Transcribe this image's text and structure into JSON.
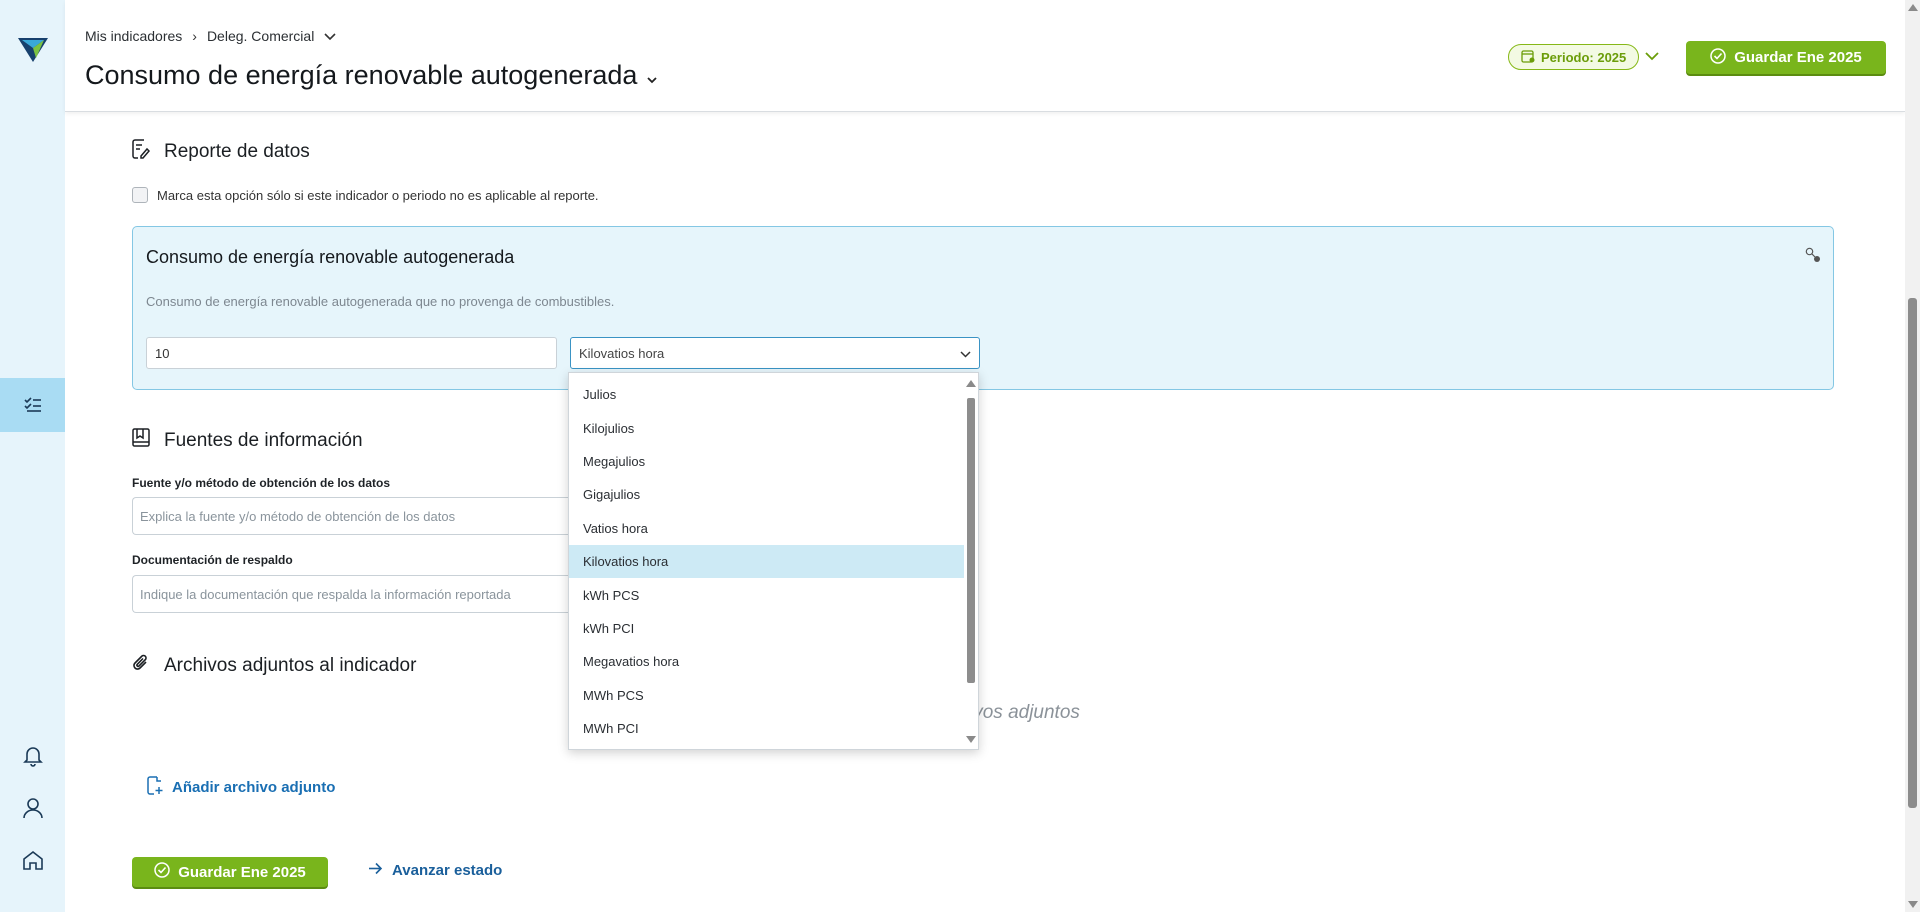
{
  "header": {
    "breadcrumb": [
      "Mis indicadores",
      "Deleg. Comercial"
    ],
    "title": "Consumo de energía renovable autogenerada",
    "period_label": "Periodo: 2025",
    "save_label": "Guardar Ene 2025"
  },
  "report": {
    "section_title": "Reporte de datos",
    "not_applicable_label": "Marca esta opción sólo si este indicador o periodo no es aplicable al reporte.",
    "card_title": "Consumo de energía renovable autogenerada",
    "card_description": "Consumo de energía renovable autogenerada que no provenga de combustibles.",
    "value": "10",
    "unit_selected": "Kilovatios hora"
  },
  "unit_options": [
    "Julios",
    "Kilojulios",
    "Megajulios",
    "Gigajulios",
    "Vatios hora",
    "Kilovatios hora",
    "kWh PCS",
    "kWh PCI",
    "Megavatios hora",
    "MWh PCS",
    "MWh PCI"
  ],
  "sources": {
    "section_title": "Fuentes de información",
    "source_label": "Fuente y/o método de obtención de los datos",
    "source_placeholder": "Explica la fuente y/o método de obtención de los datos",
    "docs_label": "Documentación de respaldo",
    "docs_placeholder": "Indique la documentación que respalda la información reportada"
  },
  "attachments": {
    "section_title": "Archivos adjuntos al indicador",
    "empty_text_visible": "ivos adjuntos",
    "add_label": "Añadir archivo adjunto"
  },
  "footer": {
    "save_label": "Guardar Ene 2025",
    "advance_label": "Avanzar estado"
  },
  "colors": {
    "accent_green": "#79b51c",
    "accent_blue": "#3a93c4",
    "rail_bg": "#e6f4fb",
    "card_bg": "#e6f5fb"
  }
}
